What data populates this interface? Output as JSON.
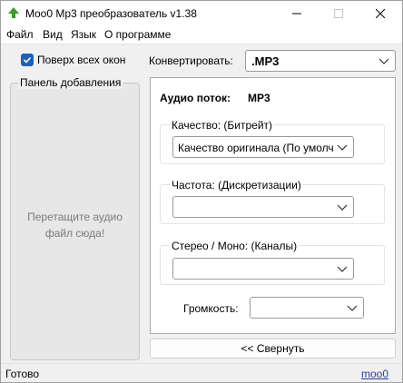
{
  "window": {
    "title": "Moo0 Mp3 преобразователь v1.38"
  },
  "menu": [
    "Файл",
    "Вид",
    "Язык",
    "О программе"
  ],
  "always_on_top": {
    "label": "Поверх всех окон",
    "checked": true
  },
  "drop_panel": {
    "title": "Панель добавления",
    "hint_line1": "Перетащите аудио",
    "hint_line2": "файл сюда!"
  },
  "convert": {
    "label": "Конвертировать:",
    "value": ".MP3"
  },
  "stream": {
    "label": "Аудио поток:",
    "value": "MP3"
  },
  "quality": {
    "title": "Качество:  (Битрейт)",
    "value": "Качество оригинала  (По умолч"
  },
  "frequency": {
    "title": "Частота:  (Дискретизации)",
    "value": ""
  },
  "channels": {
    "title": "Стерео / Моно:  (Каналы)",
    "value": ""
  },
  "volume": {
    "label": "Громкость:",
    "value": ""
  },
  "collapse_button": "<< Свернуть",
  "status": "Готово",
  "link": "moo0",
  "colors": {
    "accent": "#1f5fb8",
    "link": "#2b3f9c",
    "logo_green": "#3a9a2a"
  }
}
